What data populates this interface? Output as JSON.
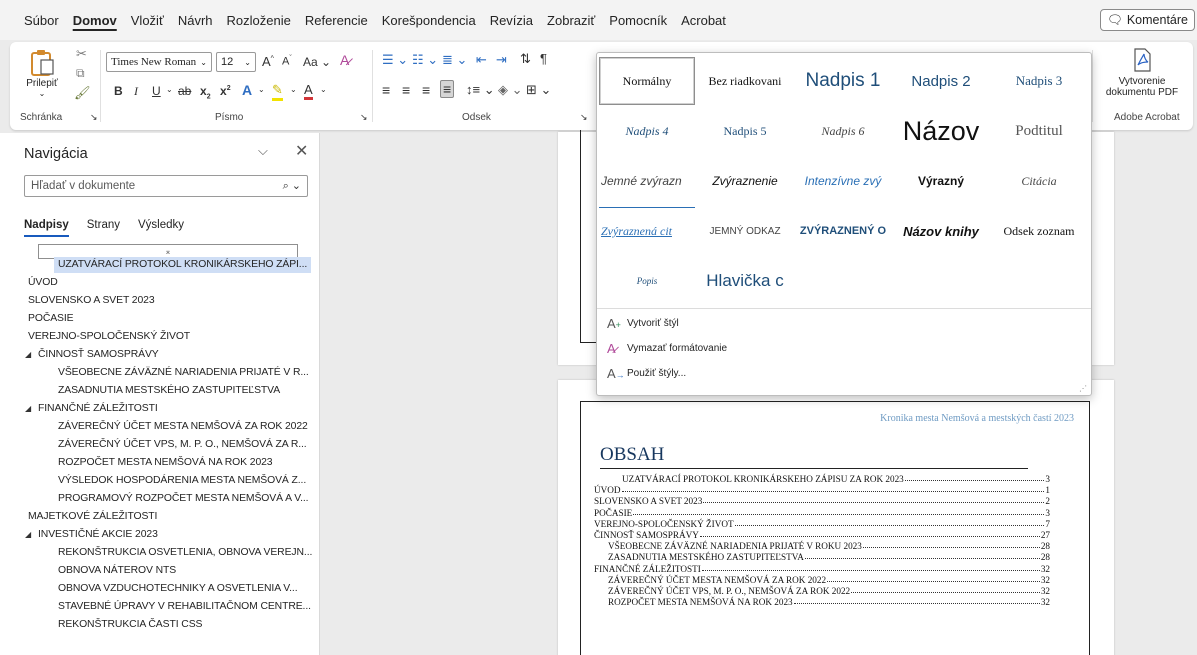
{
  "menu": {
    "items": [
      "Súbor",
      "Domov",
      "Vložiť",
      "Návrh",
      "Rozloženie",
      "Referencie",
      "Korešpondencia",
      "Revízia",
      "Zobraziť",
      "Pomocník",
      "Acrobat"
    ],
    "active_index": 1,
    "comments_label": "Komentáre"
  },
  "ribbon": {
    "paste_label": "Prilepiť",
    "clipboard_group": "Schránka",
    "font_name": "Times New Roman",
    "font_size": "12",
    "font_group": "Písmo",
    "paragraph_group": "Odsek",
    "pdf_label_1": "Vytvorenie",
    "pdf_label_2": "dokumentu PDF",
    "acrobat_group": "Adobe Acrobat",
    "case_label": "Aa"
  },
  "nav": {
    "title": "Navigácia",
    "search_placeholder": "Hľadať v dokumente",
    "tabs": [
      "Nadpisy",
      "Strany",
      "Výsledky"
    ],
    "drop_marker": "⌅",
    "items": [
      {
        "label": "UZATVÁRACÍ PROTOKOL KRONIKÁRSKEHO ZÁPI...",
        "level": 2,
        "selected": true
      },
      {
        "label": "ÚVOD",
        "level": 1
      },
      {
        "label": "SLOVENSKO A SVET 2023",
        "level": 1
      },
      {
        "label": "POČASIE",
        "level": 1
      },
      {
        "label": "VEREJNO-SPOLOČENSKÝ ŽIVOT",
        "level": 1
      },
      {
        "label": "ČINNOSŤ SAMOSPRÁVY",
        "level": 1,
        "expanded": true
      },
      {
        "label": "VŠEOBECNE ZÁVÄZNÉ NARIADENIA PRIJATÉ V R...",
        "level": 2
      },
      {
        "label": "ZASADNUTIA MESTSKÉHO ZASTUPITEĽSTVA",
        "level": 2
      },
      {
        "label": "FINANČNÉ ZÁLEŽITOSTI",
        "level": 1,
        "expanded": true
      },
      {
        "label": "ZÁVEREČNÝ ÚČET MESTA NEMŠOVÁ ZA ROK 2022",
        "level": 2
      },
      {
        "label": "ZÁVEREČNÝ ÚČET VPS, M. P. O., NEMŠOVÁ ZA R...",
        "level": 2
      },
      {
        "label": "ROZPOČET MESTA NEMŠOVÁ NA ROK 2023",
        "level": 2
      },
      {
        "label": "VÝSLEDOK HOSPODÁRENIA MESTA NEMŠOVÁ Z...",
        "level": 2
      },
      {
        "label": "PROGRAMOVÝ ROZPOČET MESTA NEMŠOVÁ A V...",
        "level": 2
      },
      {
        "label": "MAJETKOVÉ ZÁLEŽITOSTI",
        "level": 1
      },
      {
        "label": "INVESTIČNÉ AKCIE 2023",
        "level": 1,
        "expanded": true
      },
      {
        "label": "REKONŠTRUKCIA OSVETLENIA, OBNOVA VEREJN...",
        "level": 2
      },
      {
        "label": "OBNOVA NÁTEROV NTS",
        "level": 2
      },
      {
        "label": "OBNOVA VZDUCHOTECHNIKY A OSVETLENIA V...",
        "level": 2
      },
      {
        "label": "STAVEBNÉ ÚPRAVY V REHABILITAČNOM CENTRE...",
        "level": 2
      },
      {
        "label": "REKONŠTRUKCIA ČASTI CSS",
        "level": 2
      }
    ]
  },
  "document": {
    "header_text": "Kronika mesta Nemšová a mestských častí 2023",
    "toc_title": "OBSAH",
    "toc": [
      {
        "text": "UZATVÁRACÍ PROTOKOL KRONIKÁRSKEHO ZÁPISU ZA ROK 2023",
        "page": "3",
        "level": 2
      },
      {
        "text": "ÚVOD",
        "page": "1",
        "level": 1
      },
      {
        "text": "SLOVENSKO A SVET 2023",
        "page": "2",
        "level": 1
      },
      {
        "text": "POČASIE",
        "page": "3",
        "level": 1
      },
      {
        "text": "VEREJNO-SPOLOČENSKÝ ŽIVOT",
        "page": "7",
        "level": 1
      },
      {
        "text": "ČINNOSŤ SAMOSPRÁVY",
        "page": "27",
        "level": 1
      },
      {
        "text": "VŠEOBECNE ZÁVÄZNÉ NARIADENIA PRIJATÉ V ROKU 2023",
        "page": "28",
        "level": 2
      },
      {
        "text": "ZASADNUTIA MESTSKÉHO ZASTUPITEĽSTVA",
        "page": "28",
        "level": 2
      },
      {
        "text": "FINANČNÉ ZÁLEŽITOSTI",
        "page": "32",
        "level": 1
      },
      {
        "text": "ZÁVEREČNÝ ÚČET MESTA NEMŠOVÁ ZA ROK 2022",
        "page": "32",
        "level": 2
      },
      {
        "text": "ZÁVEREČNÝ ÚČET VPS, M. P. O., NEMŠOVÁ ZA ROK 2022",
        "page": "32",
        "level": 2
      },
      {
        "text": "ROZPOČET MESTA NEMŠOVÁ NA ROK 2023",
        "page": "32",
        "level": 2
      }
    ]
  },
  "styles_gallery": {
    "styles": [
      {
        "label": "Normálny",
        "selected": true
      },
      {
        "label": "Bez riadkovani"
      },
      {
        "label": "Nadpis 1"
      },
      {
        "label": "Nadpis 2"
      },
      {
        "label": "Nadpis 3"
      },
      {
        "label": "Nadpis 4"
      },
      {
        "label": "Nadpis 5"
      },
      {
        "label": "Nadpis 6"
      },
      {
        "label": "Názov"
      },
      {
        "label": "Podtitul"
      },
      {
        "label": "Jemné zvýrazn"
      },
      {
        "label": "Zvýraznenie"
      },
      {
        "label": "Intenzívne zvý"
      },
      {
        "label": "Výrazný"
      },
      {
        "label": "Citácia"
      },
      {
        "label": "Zvýraznená cit"
      },
      {
        "label": "JEMNÝ ODKAZ"
      },
      {
        "label": "ZVÝRAZNENÝ O"
      },
      {
        "label": "Názov knihy"
      },
      {
        "label": "Odsek zoznam"
      },
      {
        "label": "Popis"
      },
      {
        "label": "Hlavička c"
      }
    ],
    "commands": [
      "Vytvoriť štýl",
      "Vymazať formátovanie",
      "Použiť štýly..."
    ],
    "accent_color": "#1f4e79"
  }
}
